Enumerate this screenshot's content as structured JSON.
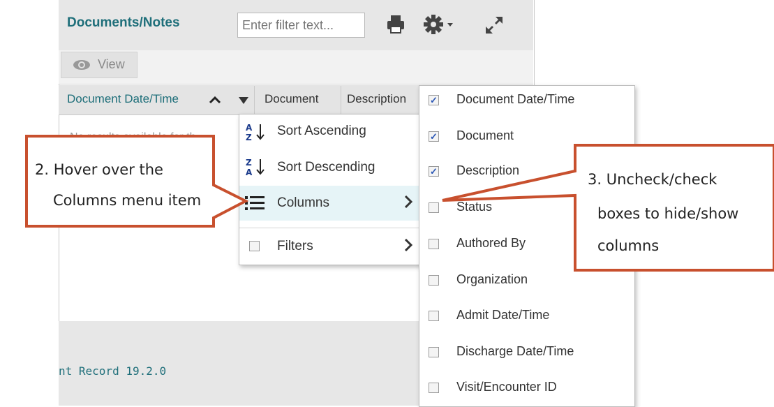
{
  "panel": {
    "title": "Documents/Notes",
    "filter_placeholder": "Enter filter text...",
    "icons": [
      "printer-icon",
      "gear-icon",
      "caret-down-icon",
      "expand-icon"
    ]
  },
  "toolbar": {
    "view_label": "View",
    "view_icon": "eye-icon"
  },
  "columns_header": {
    "col1": "Document Date/Time",
    "col2": "Document",
    "col3": "Description"
  },
  "grid": {
    "empty_text": "No results available for th"
  },
  "footer": {
    "version": "nt Record 19.2.0"
  },
  "context_menu": {
    "sort_asc": "Sort Ascending",
    "sort_desc": "Sort Descending",
    "columns": "Columns",
    "filters": "Filters"
  },
  "column_options": [
    {
      "label": "Document Date/Time",
      "checked": true
    },
    {
      "label": "Document",
      "checked": true
    },
    {
      "label": "Description",
      "checked": true
    },
    {
      "label": "Status",
      "checked": false
    },
    {
      "label": "Authored By",
      "checked": false
    },
    {
      "label": "Organization",
      "checked": false
    },
    {
      "label": "Admit Date/Time",
      "checked": false
    },
    {
      "label": "Discharge Date/Time",
      "checked": false
    },
    {
      "label": "Visit/Encounter ID",
      "checked": false
    }
  ],
  "callouts": {
    "step2_line1": "2. Hover over the",
    "step2_line2": "Columns menu item",
    "step3_line1": "3. Uncheck/check",
    "step3_line2": "boxes to hide/show",
    "step3_line3": "columns",
    "border_color": "#c8502e"
  },
  "colors": {
    "accent": "#1f6f7a",
    "highlight": "#e6f4f7",
    "checkbox_check": "#2a56b5"
  }
}
